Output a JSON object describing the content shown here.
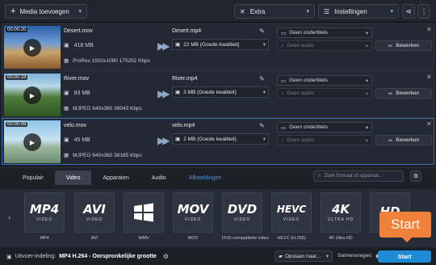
{
  "toolbar": {
    "add_media_label": "Media toevoegen",
    "extra_label": "Extra",
    "settings_label": "Instellingen"
  },
  "files": [
    {
      "duration": "00:00:20",
      "input_name": "Desert.mov",
      "input_size": "418 MB",
      "input_info": "ProRes 1920x1080 175252 Kbps",
      "output_name": "Desert.mp4",
      "output_size": "22 MB (Goede kwaliteit)",
      "subtitles": "Geen ondertitels",
      "audio": "Geen audio",
      "edit_label": "Bewerken"
    },
    {
      "duration": "00:00:19",
      "input_name": "River.mov",
      "input_size": "83 MB",
      "input_info": "MJPEG 640x360 36043 Kbps",
      "output_name": "River.mp4",
      "output_size": "3 MB (Goede kwaliteit)",
      "subtitles": "Geen ondertitels",
      "audio": "Geen audio",
      "edit_label": "Bewerken"
    },
    {
      "duration": "00:00:09",
      "input_name": "velo.mov",
      "input_size": "45 MB",
      "input_info": "MJPEG 640x360 38185 Kbps",
      "output_name": "velo.mp4",
      "output_size": "2 MB (Goede kwaliteit)",
      "subtitles": "Geen ondertitels",
      "audio": "Geen audio",
      "edit_label": "Bewerken"
    }
  ],
  "tabs": [
    "Populair",
    "Video",
    "Apparaten",
    "Audio",
    "Afbeeldingen"
  ],
  "search_placeholder": "Zoek formaat of apparaat...",
  "formats": [
    {
      "big": "MP4",
      "small": "VIDEO",
      "label": "MP4"
    },
    {
      "big": "AVI",
      "small": "VIDEO",
      "label": "AVI"
    },
    {
      "big": "",
      "small": "",
      "label": "WMV"
    },
    {
      "big": "MOV",
      "small": "VIDEO",
      "label": "MOV"
    },
    {
      "big": "DVD",
      "small": "VIDEO",
      "label": "DVD-compatibele video"
    },
    {
      "big": "HEVC",
      "small": "VIDEO",
      "label": "HEVC (H.265)"
    },
    {
      "big": "4K",
      "small": "ULTRA HD",
      "label": "4K Ultra HD"
    },
    {
      "big": "HD",
      "small": "",
      "label": ""
    }
  ],
  "status": {
    "output_label": "Uitvoer-indeling:",
    "output_value": "MP4 H.264 - Oorspronkelijke grootte",
    "save_label": "Opslaan naar...",
    "merge_label": "Samenvoegen:",
    "start_label": "Start"
  },
  "callout_label": "Start",
  "colors": {
    "accent": "#1f8bd6",
    "callout": "#f0813a",
    "tab_accent": "#4a90e2"
  }
}
